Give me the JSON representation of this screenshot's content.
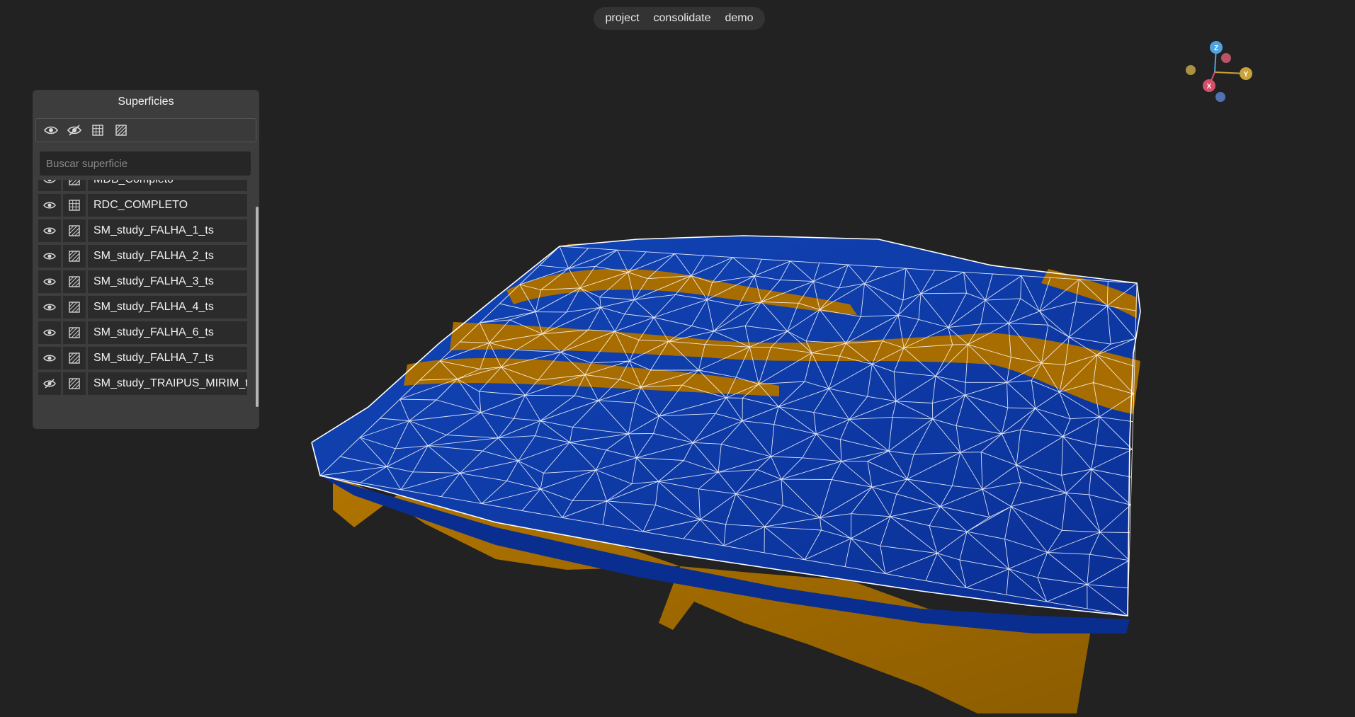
{
  "menu": {
    "items": [
      {
        "label": "project"
      },
      {
        "label": "consolidate"
      },
      {
        "label": "demo"
      }
    ]
  },
  "panel": {
    "title": "Superficies",
    "toolbar": {
      "icons": [
        "eye-icon",
        "eye-off-icon",
        "grid-icon",
        "hatch-icon"
      ]
    },
    "search": {
      "placeholder": "Buscar superficie",
      "value": ""
    },
    "surfaces": [
      {
        "name": "MDB_Completo",
        "visible": true,
        "type": "hatch-icon"
      },
      {
        "name": "RDC_COMPLETO",
        "visible": true,
        "type": "grid-icon"
      },
      {
        "name": "SM_study_FALHA_1_ts",
        "visible": true,
        "type": "hatch-icon"
      },
      {
        "name": "SM_study_FALHA_2_ts",
        "visible": true,
        "type": "hatch-icon"
      },
      {
        "name": "SM_study_FALHA_3_ts",
        "visible": true,
        "type": "hatch-icon"
      },
      {
        "name": "SM_study_FALHA_4_ts",
        "visible": true,
        "type": "hatch-icon"
      },
      {
        "name": "SM_study_FALHA_6_ts",
        "visible": true,
        "type": "hatch-icon"
      },
      {
        "name": "SM_study_FALHA_7_ts",
        "visible": true,
        "type": "hatch-icon"
      },
      {
        "name": "SM_study_TRAIPUS_MIRIM_ts",
        "visible": false,
        "type": "hatch-icon"
      }
    ]
  },
  "gizmo": {
    "axes": [
      "Z",
      "Y",
      "X"
    ]
  },
  "colors": {
    "background": "#222222",
    "surface_blue": "#0b36a3",
    "fault_orange": "#a86d00",
    "wireframe": "#ffffff"
  }
}
